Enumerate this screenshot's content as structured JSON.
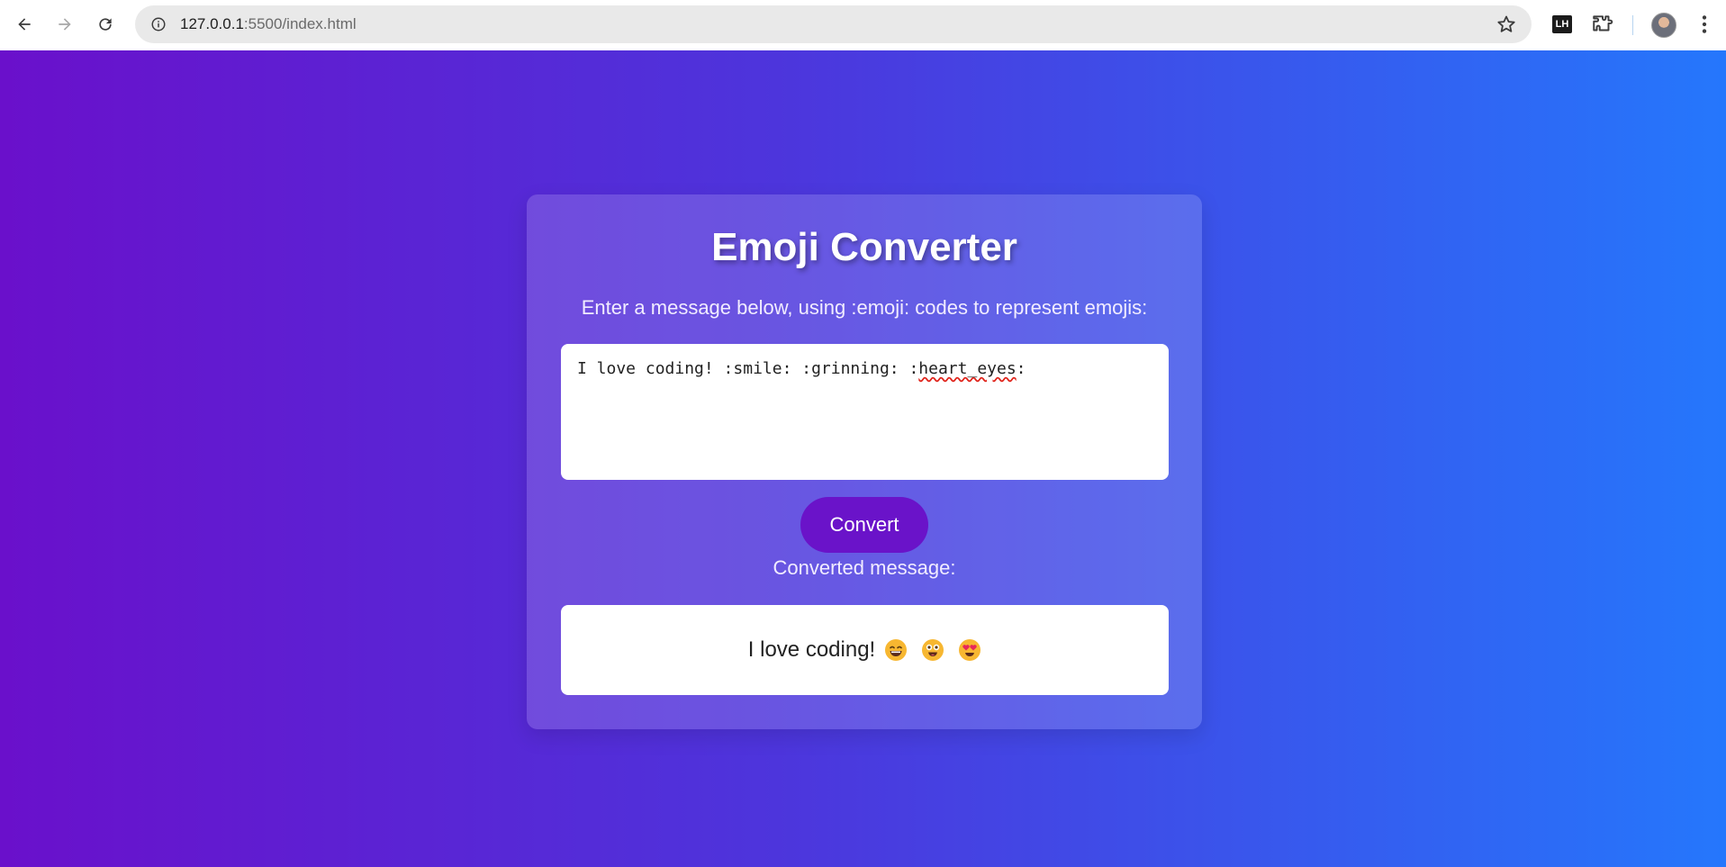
{
  "browser": {
    "url_host": "127.0.0.1",
    "url_path": ":5500/index.html",
    "extension_badge": "LH"
  },
  "app": {
    "title": "Emoji Converter",
    "instructions": "Enter a message below, using :emoji: codes to represent emojis:",
    "input_value_prefix": "I love coding! :smile: :grinning: :",
    "input_value_misspelled": "heart_eyes",
    "input_value_suffix": ":",
    "convert_label": "Convert",
    "output_label": "Converted message:",
    "output_text": "I love coding!",
    "output_emojis": [
      "smile-emoji",
      "grinning-emoji",
      "heart-eyes-emoji"
    ]
  },
  "colors": {
    "gradient_start": "#6a10cb",
    "gradient_end": "#2577fc",
    "button": "#6a13c9"
  }
}
